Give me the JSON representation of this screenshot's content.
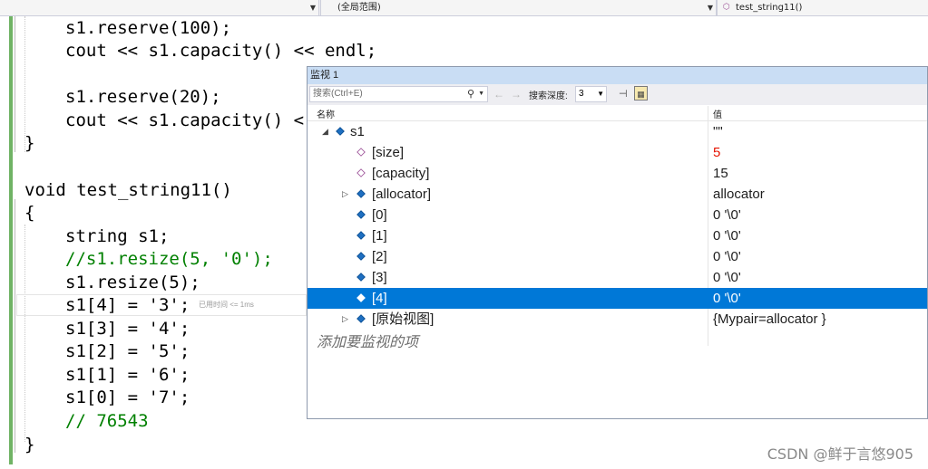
{
  "nav": {
    "scope": "(全局范围)",
    "function": "test_string11()"
  },
  "code": {
    "lines": [
      "s1.reserve(100);",
      "cout << s1.capacity() << endl;",
      "s1.reserve(20);",
      "cout << s1.capacity() <",
      "}",
      "void test_string11()",
      "{",
      "string s1;",
      "//s1.resize(5, '0');",
      "s1.resize(5);",
      "s1[4] = '3';",
      "s1[3] = '4';",
      "s1[2] = '5';",
      "s1[1] = '6';",
      "s1[0] = '7';",
      "// 76543",
      "}"
    ],
    "elapsed_hint": "已用时间 <= 1ms"
  },
  "watch": {
    "title": "监视 1",
    "search_placeholder": "搜索(Ctrl+E)",
    "depth_label": "搜索深度:",
    "depth_value": "3",
    "col_name": "名称",
    "col_value": "值",
    "rows": [
      {
        "name": "s1",
        "value": "\"\""
      },
      {
        "name": "[size]",
        "value": "5"
      },
      {
        "name": "[capacity]",
        "value": "15"
      },
      {
        "name": "[allocator]",
        "value": "allocator"
      },
      {
        "name": "[0]",
        "value": "0 '\\0'"
      },
      {
        "name": "[1]",
        "value": "0 '\\0'"
      },
      {
        "name": "[2]",
        "value": "0 '\\0'"
      },
      {
        "name": "[3]",
        "value": "0 '\\0'"
      },
      {
        "name": "[4]",
        "value": "0 '\\0'"
      },
      {
        "name": "[原始视图]",
        "value": "{Mypair=allocator }"
      }
    ],
    "add_item_hint": "添加要监视的项"
  },
  "watermark": "CSDN @鲜于言悠905",
  "colors": {
    "selection": "#0078d7",
    "changed_value": "#e51400",
    "keyword": "#0000ff",
    "string": "#a31515",
    "comment": "#008000"
  }
}
